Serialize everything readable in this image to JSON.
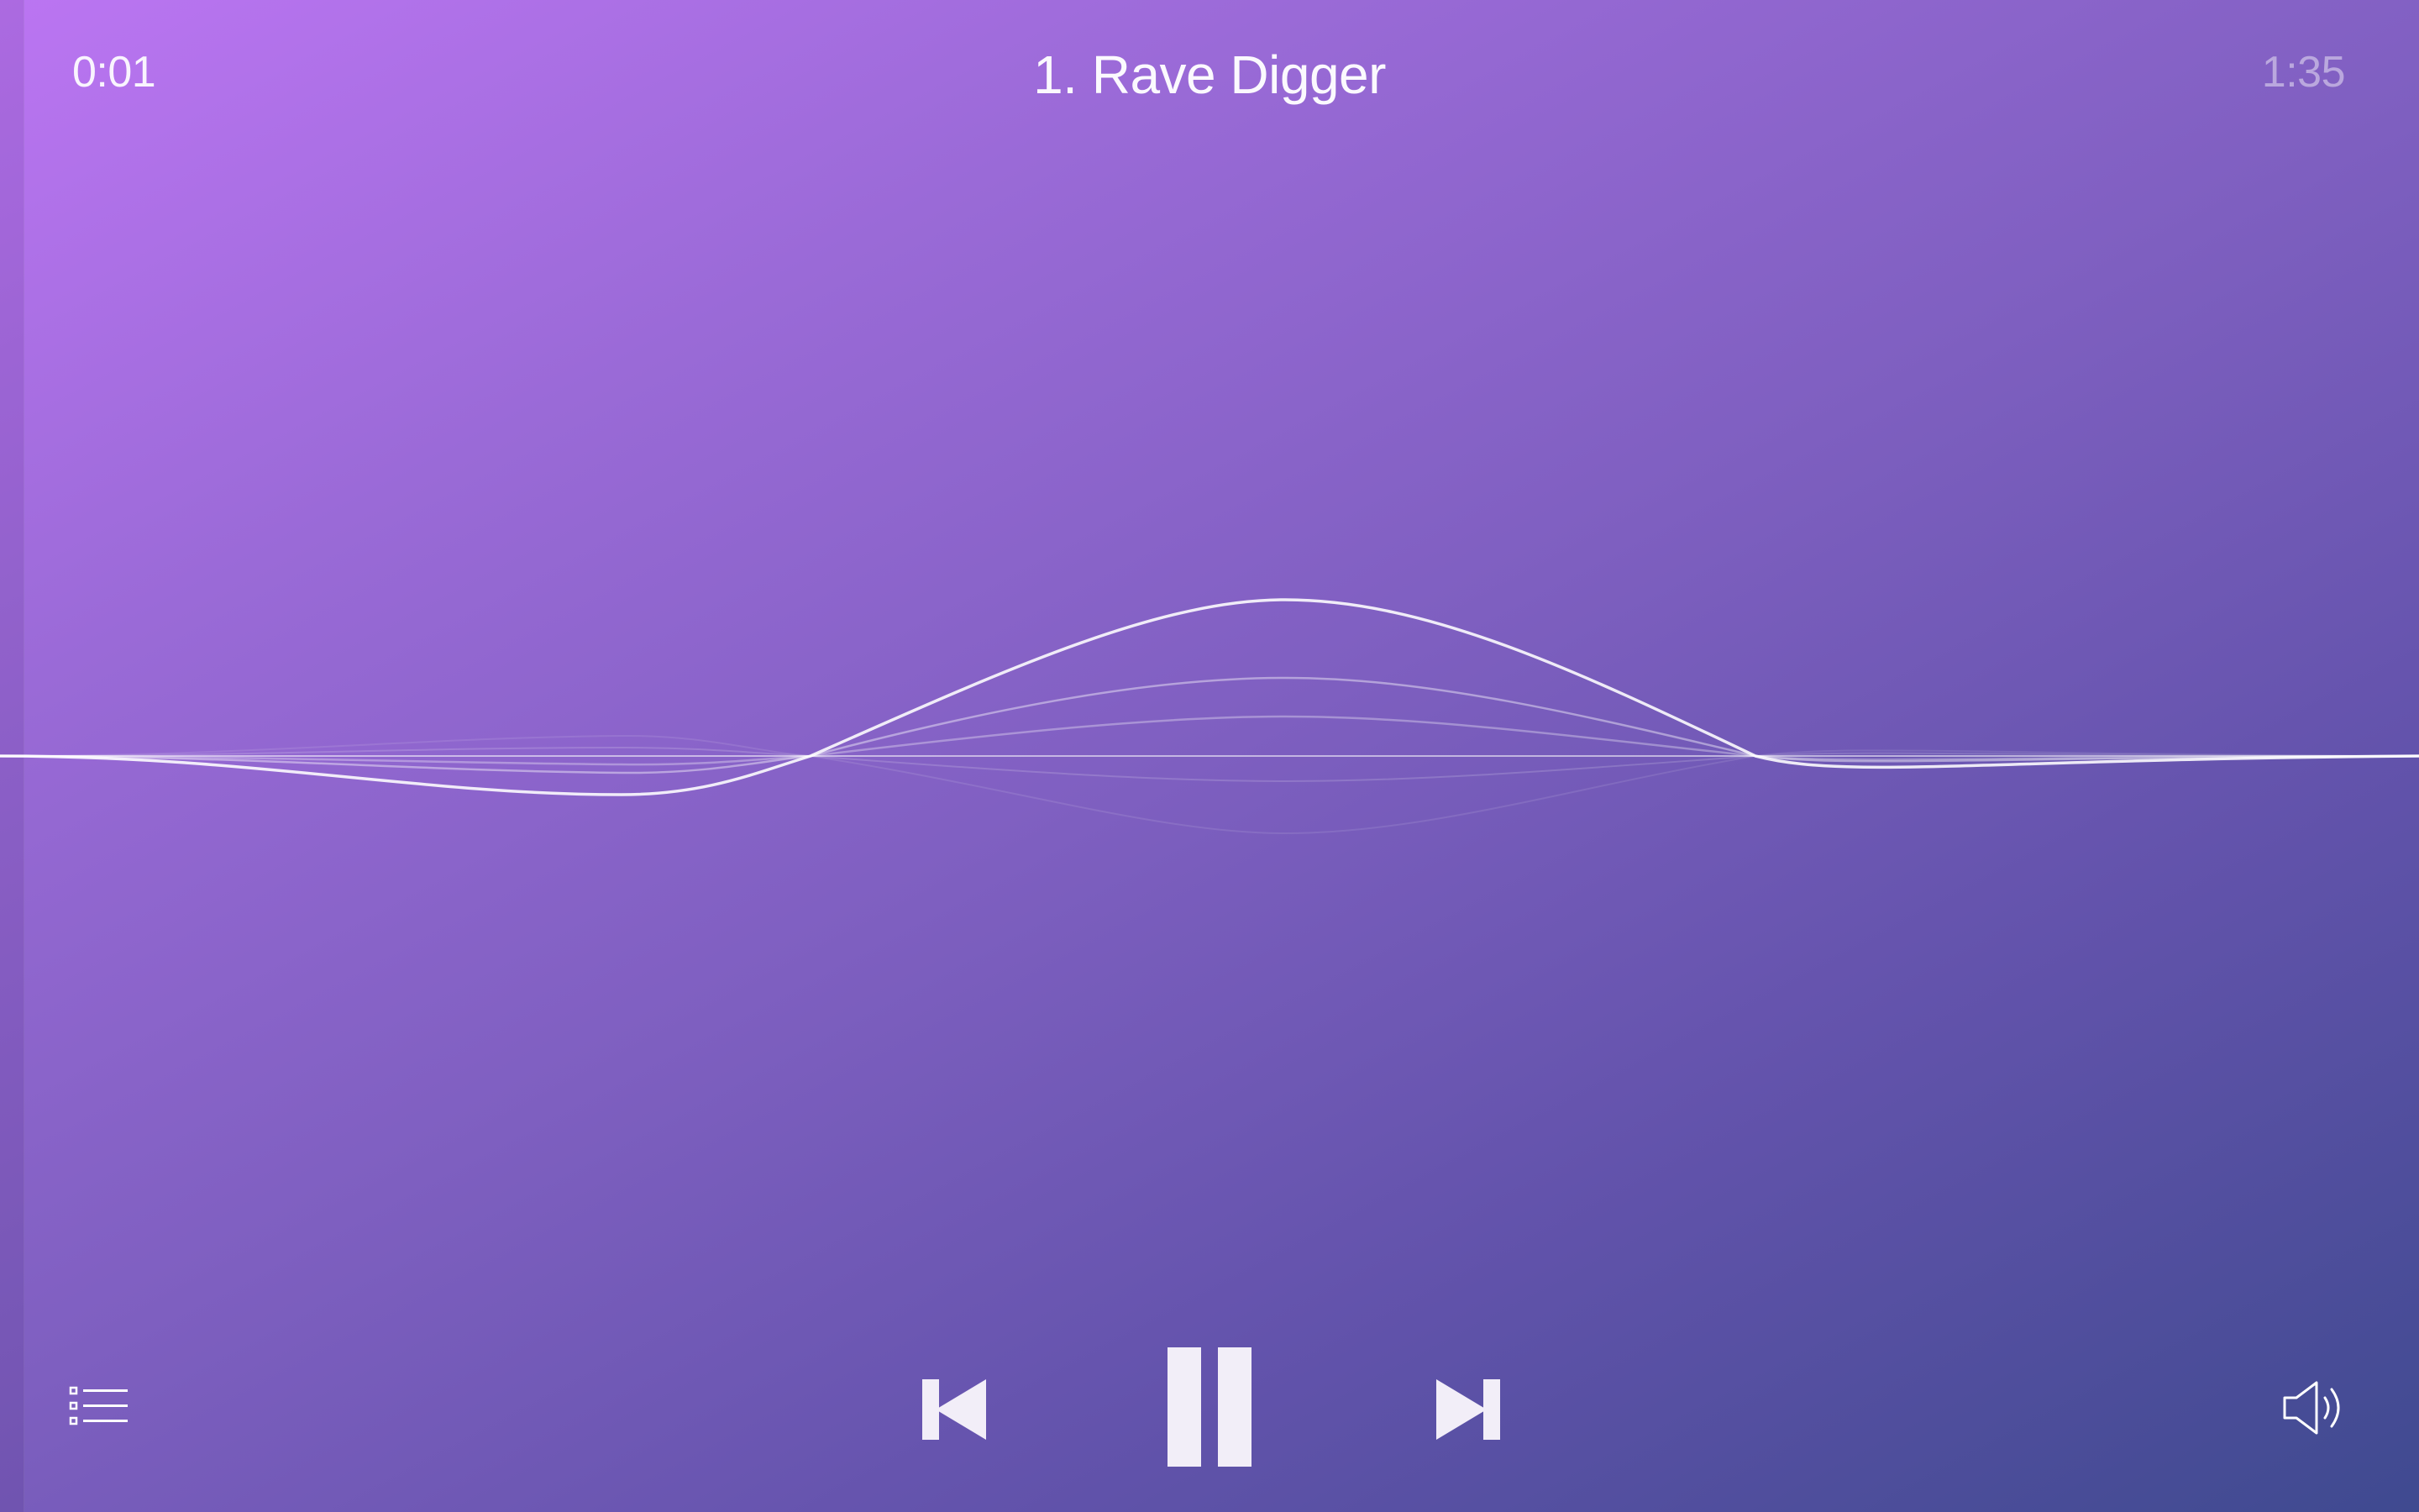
{
  "player": {
    "elapsed": "0:01",
    "title": "1. Rave Digger",
    "duration": "1:35",
    "state": "playing"
  },
  "controls": {
    "playlist_icon": "list-icon",
    "prev_icon": "skip-back-icon",
    "pause_icon": "pause-icon",
    "next_icon": "skip-forward-icon",
    "volume_icon": "speaker-icon"
  },
  "colors": {
    "gradient_start": "#bb75f2",
    "gradient_end": "#3f4a90",
    "foreground": "#ffffff"
  }
}
